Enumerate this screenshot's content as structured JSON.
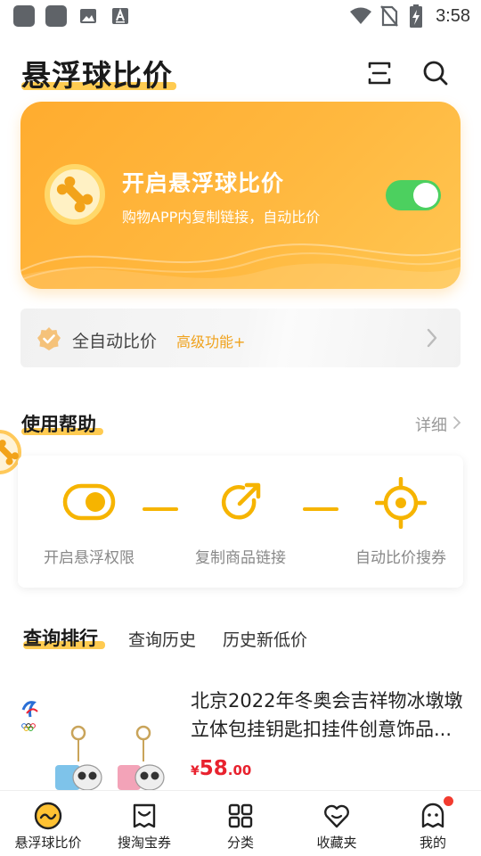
{
  "status_bar": {
    "time": "3:58",
    "icons": [
      "app-icon",
      "app-icon",
      "gallery-icon",
      "font-icon",
      "wifi-icon",
      "no-sim-icon",
      "battery-icon"
    ]
  },
  "header": {
    "title": "悬浮球比价",
    "icons": [
      "scan-icon",
      "search-icon"
    ]
  },
  "hero": {
    "title": "开启悬浮球比价",
    "subtitle": "购物APP内复制链接，自动比价",
    "toggle_on": true,
    "colors": {
      "gradient_start": "#ffac2f",
      "gradient_end": "#ffc652",
      "toggle": "#4cd05f"
    }
  },
  "auto_compare": {
    "label": "全自动比价",
    "badge": "高级功能+"
  },
  "help": {
    "title": "使用帮助",
    "detail_link": "详细",
    "steps": [
      {
        "label": "开启悬浮权限",
        "icon": "toggle-icon"
      },
      {
        "label": "复制商品链接",
        "icon": "share-icon"
      },
      {
        "label": "自动比价搜券",
        "icon": "target-icon"
      }
    ]
  },
  "tabs": [
    {
      "label": "查询排行",
      "active": true
    },
    {
      "label": "查询历史",
      "active": false
    },
    {
      "label": "历史新低价",
      "active": false
    }
  ],
  "product": {
    "title": "北京2022年冬奥会吉祥物冰墩墩立体包挂钥匙扣挂件创意饰品...",
    "price_symbol": "¥",
    "price_int": "58",
    "price_dec": ".00"
  },
  "bottom_nav": [
    {
      "label": "悬浮球比价",
      "icon": "float-ball-icon",
      "active": true
    },
    {
      "label": "搜淘宝券",
      "icon": "coupon-icon",
      "active": false
    },
    {
      "label": "分类",
      "icon": "grid-icon",
      "active": false
    },
    {
      "label": "收藏夹",
      "icon": "heart-icon",
      "active": false
    },
    {
      "label": "我的",
      "icon": "profile-icon",
      "active": false,
      "has_dot": true
    }
  ],
  "accent_color": "#ffc233",
  "price_color": "#e8222e"
}
